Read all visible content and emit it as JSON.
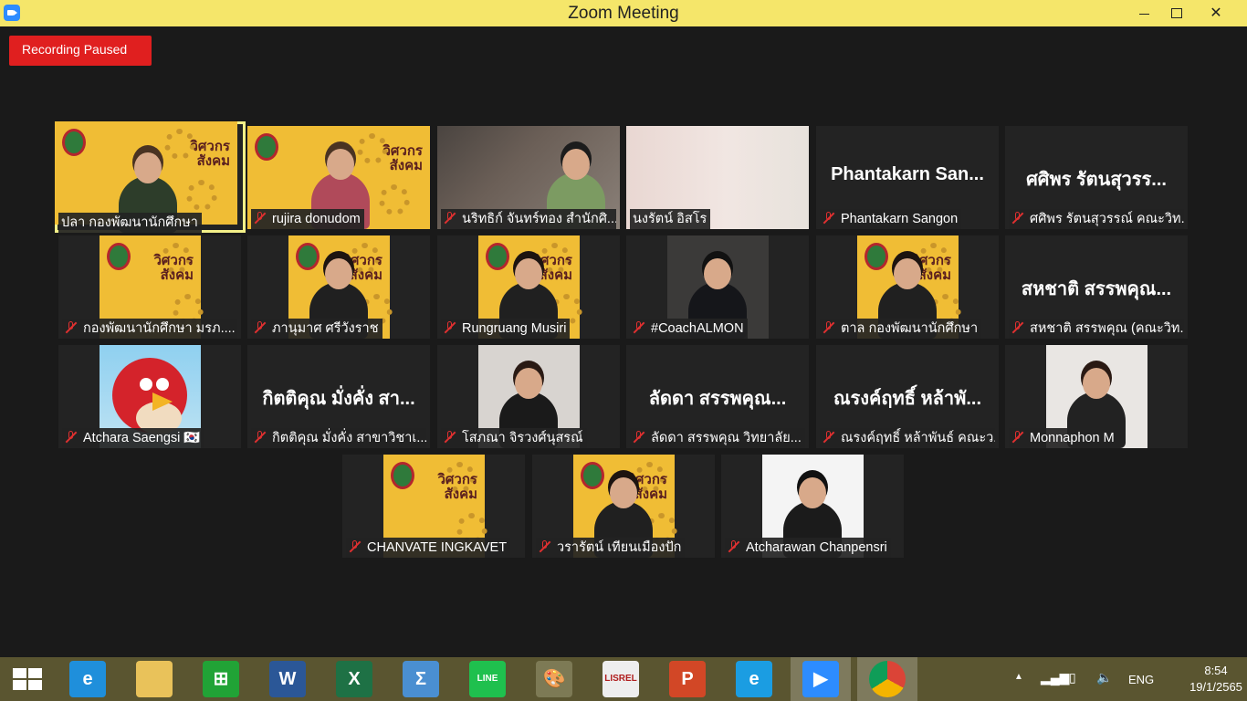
{
  "window": {
    "title": "Zoom Meeting"
  },
  "recording": {
    "label": "Recording Paused"
  },
  "participants": [
    {
      "name": "ปลา กองพัฒนานักศึกษา",
      "muted": false,
      "big_name": ""
    },
    {
      "name": "rujira donudom",
      "muted": true,
      "big_name": ""
    },
    {
      "name": "นริทธิก์ จันทร์ทอง สำนักศิ...",
      "muted": true,
      "big_name": ""
    },
    {
      "name": "นงรัตน์ อิสโร",
      "muted": false,
      "big_name": ""
    },
    {
      "name": "Phantakarn Sangon",
      "muted": true,
      "big_name": "Phantakarn San..."
    },
    {
      "name": "ศศิพร รัตนสุวรรณ์ คณะวิท...",
      "muted": true,
      "big_name": "ศศิพร รัตนสุวรร..."
    },
    {
      "name": "กองพัฒนานักศึกษา มรภ....",
      "muted": true,
      "big_name": ""
    },
    {
      "name": "ภานุมาศ ศรีวังราช",
      "muted": true,
      "big_name": ""
    },
    {
      "name": "Rungruang Musiri",
      "muted": true,
      "big_name": ""
    },
    {
      "name": "#CoachALMON",
      "muted": true,
      "big_name": ""
    },
    {
      "name": "ตาล กองพัฒนานักศึกษา",
      "muted": true,
      "big_name": ""
    },
    {
      "name": "สหชาติ สรรพคุณ (คณะวิท...",
      "muted": true,
      "big_name": "สหชาติ สรรพคุณ..."
    },
    {
      "name": "Atchara Saengsi 🇰🇷",
      "muted": true,
      "big_name": ""
    },
    {
      "name": "กิตติคุณ  มั่งคั่ง สาขาวิชาเ...",
      "muted": true,
      "big_name": "กิตติคุณ  มั่งคั่ง สา..."
    },
    {
      "name": "โสภณา จิรวงศ์นุสรณ์",
      "muted": true,
      "big_name": ""
    },
    {
      "name": "ลัดดา สรรพคุณ  วิทยาลัย...",
      "muted": true,
      "big_name": "ลัดดา สรรพคุณ..."
    },
    {
      "name": "ณรงค์ฤทธิ์ หล้าพันธ์ คณะว...",
      "muted": true,
      "big_name": "ณรงค์ฤทธิ์ หล้าพั..."
    },
    {
      "name": "Monnaphon M",
      "muted": true,
      "big_name": ""
    },
    {
      "name": "CHANVATE INGKAVET",
      "muted": true,
      "big_name": ""
    },
    {
      "name": "วรารัตน์ เทียนเมืองปัก",
      "muted": true,
      "big_name": ""
    },
    {
      "name": "Atcharawan Chanpensri",
      "muted": true,
      "big_name": ""
    }
  ],
  "poster_text": {
    "line1": "วิศวกร",
    "line2": "สังคม"
  },
  "taskbar": {
    "apps": [
      {
        "name": "Internet Explorer",
        "glyph": "e",
        "color": "#1f8fdb"
      },
      {
        "name": "File Explorer",
        "glyph": "",
        "color": "#e9c25a"
      },
      {
        "name": "Microsoft Store",
        "glyph": "⊞",
        "color": "#21a336"
      },
      {
        "name": "Word",
        "glyph": "W",
        "color": "#2b5797"
      },
      {
        "name": "Excel",
        "glyph": "X",
        "color": "#1e7145"
      },
      {
        "name": "Math Input",
        "glyph": "Σ",
        "color": "#4a8fd1"
      },
      {
        "name": "LINE",
        "glyph": "LINE",
        "color": "#1fc04e"
      },
      {
        "name": "Paint",
        "glyph": "🎨",
        "color": "#7d7a55"
      },
      {
        "name": "LISREL",
        "glyph": "LISREL",
        "color": "#eeeeee"
      },
      {
        "name": "PowerPoint",
        "glyph": "P",
        "color": "#d24726"
      },
      {
        "name": "Edge",
        "glyph": "e",
        "color": "#1b9de2"
      },
      {
        "name": "Zoom",
        "glyph": "▶",
        "color": "#2d8cff"
      },
      {
        "name": "Chrome",
        "glyph": "",
        "color": "#dddddd"
      }
    ],
    "language": "ENG",
    "time": "8:54",
    "date": "19/1/2565"
  }
}
